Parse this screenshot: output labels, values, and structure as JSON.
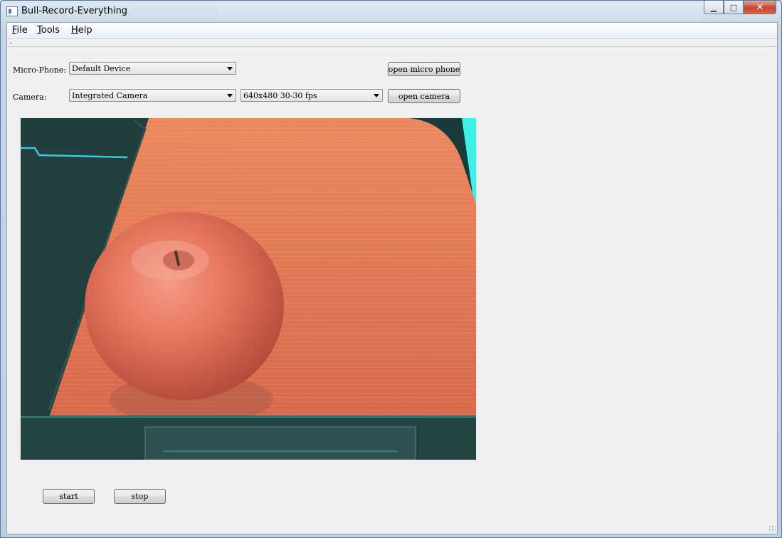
{
  "window": {
    "title": "Bull-Record-Everything"
  },
  "menu": {
    "items": [
      {
        "label": "File",
        "key": "F",
        "rest": "ile"
      },
      {
        "label": "Tools",
        "key": "T",
        "rest": "ools"
      },
      {
        "label": "Help",
        "key": "H",
        "rest": "elp"
      }
    ]
  },
  "microphone": {
    "label": "Micro-Phone:",
    "selected": "Default Device",
    "open_button": "open micro phone"
  },
  "camera": {
    "label": "Camera:",
    "selected": "Integrated Camera",
    "format_selected": "640x480 30-30 fps",
    "open_button": "open camera"
  },
  "controls": {
    "start_label": "start",
    "stop_label": "stop"
  },
  "icons": {
    "app": "app-window-icon",
    "minimize": "minimize-icon",
    "maximize": "maximize-icon",
    "close": "close-icon"
  },
  "colors": {
    "close_button": "#c7462c",
    "client_bg": "#f0f0f0"
  }
}
